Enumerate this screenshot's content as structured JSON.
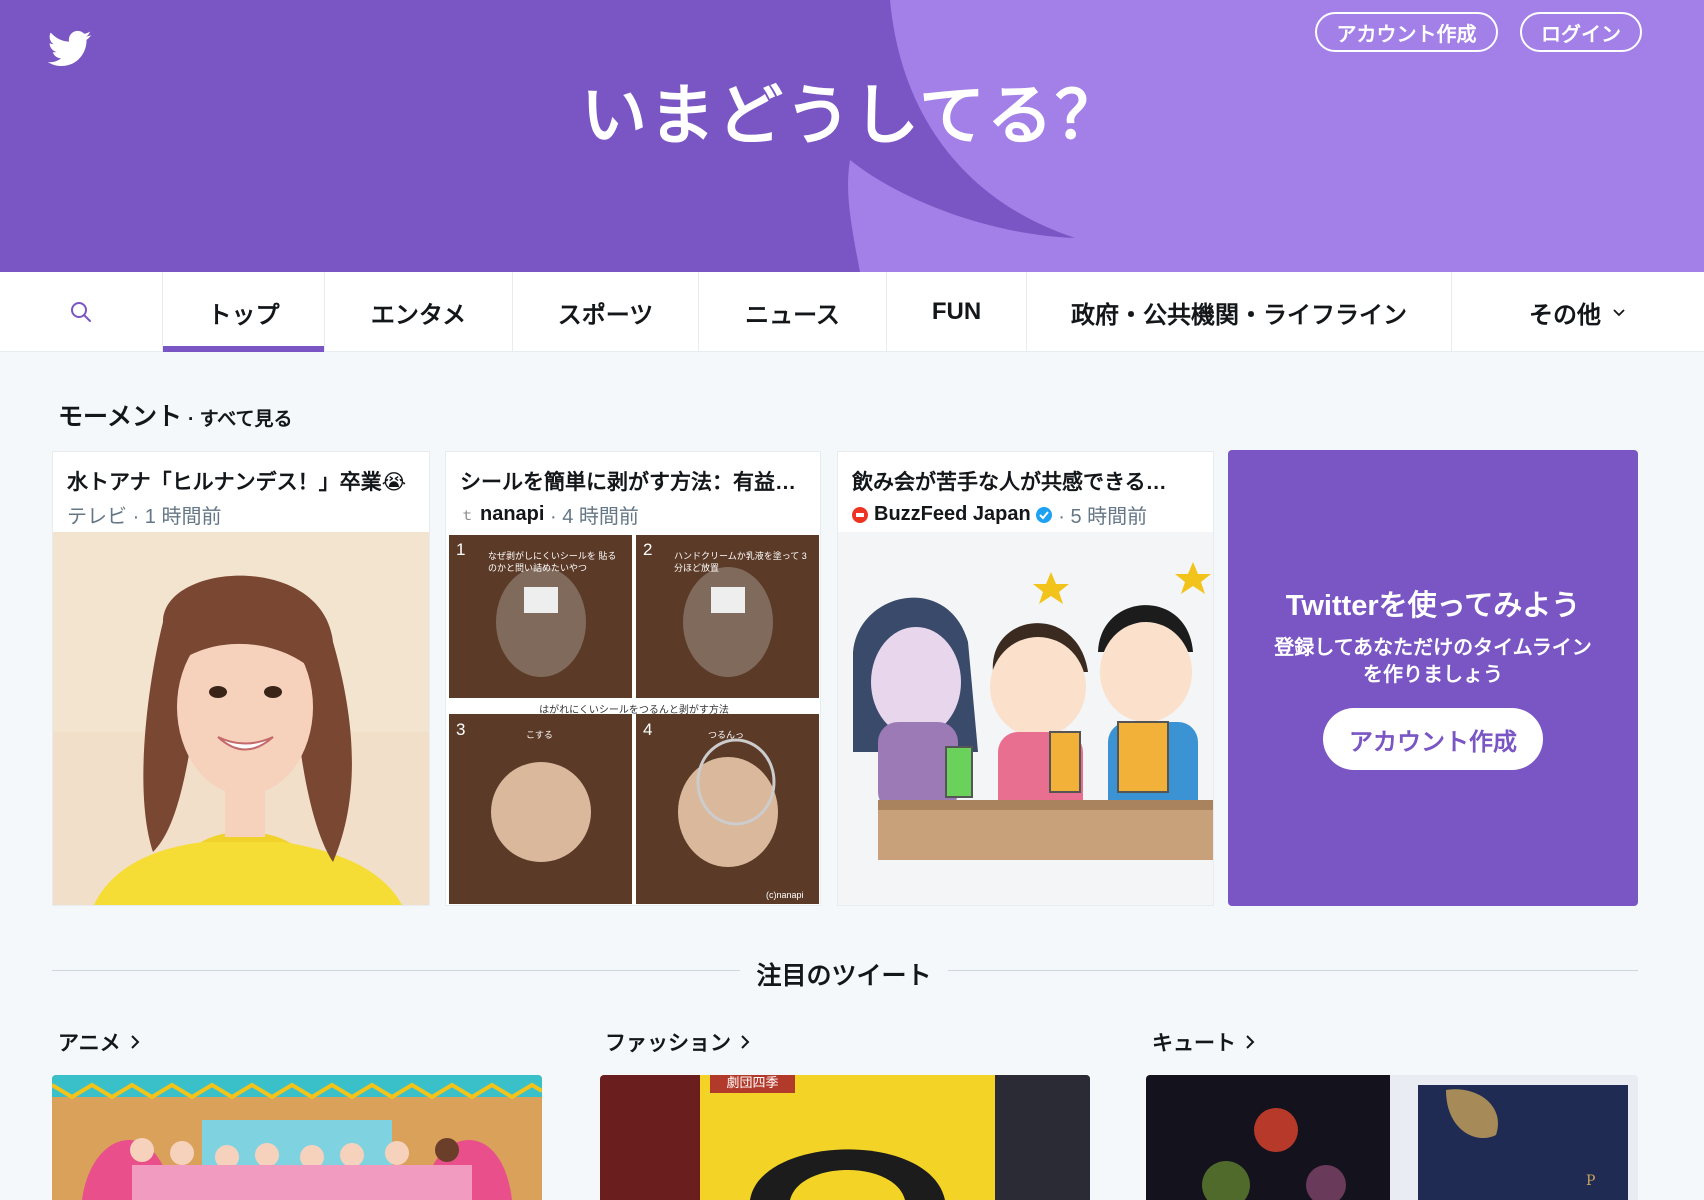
{
  "header": {
    "headline": "いまどうしてる？",
    "signup_label": "アカウント作成",
    "login_label": "ログイン"
  },
  "nav": {
    "tabs": [
      {
        "label": "トップ",
        "active": true
      },
      {
        "label": "エンタメ"
      },
      {
        "label": "スポーツ"
      },
      {
        "label": "ニュース"
      },
      {
        "label": "FUN"
      },
      {
        "label": "政府・公共機関・ライフライン"
      },
      {
        "label": "その他"
      }
    ]
  },
  "moments": {
    "title": "モーメント",
    "see_all": "· すべて見る",
    "cards": [
      {
        "title": "水トアナ「ヒルナンデス！」卒業😭",
        "source": "テレビ",
        "time": "· 1 時間前"
      },
      {
        "title": "シールを簡単に剥がす方法：有益メモ",
        "source": "nanapi",
        "time": "· 4 時間前"
      },
      {
        "title": "飲み会が苦手な人が共感できる…",
        "source": "BuzzFeed Japan",
        "time": "· 5 時間前"
      }
    ],
    "grid_caption": "はがれにくいシールをつるんと剥がす方法",
    "grid_step_numbers": [
      "1",
      "2",
      "3",
      "4"
    ],
    "grid_notes": [
      "なぜ剥がしにくいシールを 貼るのかと問い詰めたいやつ",
      "ハンドクリームか乳液を塗って 3分ほど放置",
      "こする",
      "つるんっ"
    ],
    "grid_credit": "(c)nanapi"
  },
  "promo": {
    "title": "Twitterを使ってみよう",
    "subtitle": "登録してあなただけのタイムラインを作りましょう",
    "button_label": "アカウント作成"
  },
  "featured": {
    "title": "注目のツイート",
    "categories": [
      {
        "label": "アニメ"
      },
      {
        "label": "ファッション"
      },
      {
        "label": "キュート"
      }
    ],
    "sign_text": "劇団四季"
  },
  "colors": {
    "brand_purple": "#7a55c4",
    "light_purple": "#a37fe8",
    "page_bg": "#f5f8fa"
  }
}
